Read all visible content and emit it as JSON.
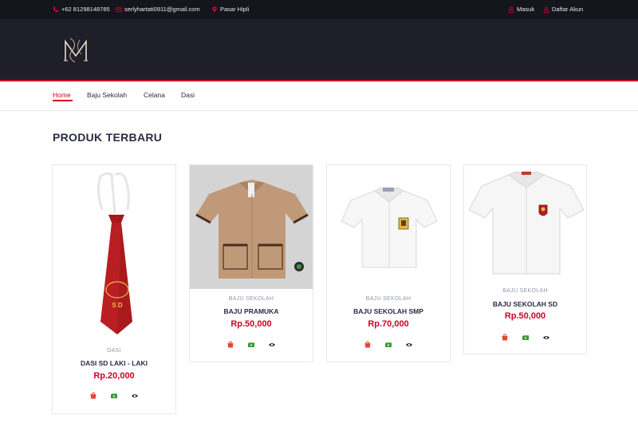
{
  "topbar": {
    "phone": "+62 81298148785",
    "email": "serlyhartati0911@gmail.com",
    "location": "Pasar Hipli",
    "login": "Masuk",
    "register": "Daftar Akun",
    "icons": [
      "phone-icon",
      "envelope-icon",
      "map-marker-icon",
      "user-icon",
      "user-icon"
    ]
  },
  "brand": {
    "logo_letters": "M"
  },
  "nav": {
    "items": [
      {
        "label": "Home",
        "active": true
      },
      {
        "label": "Baju Sekolah",
        "active": false
      },
      {
        "label": "Celana",
        "active": false
      },
      {
        "label": "Dasi",
        "active": false
      }
    ]
  },
  "section": {
    "title": "PRODUK TERBARU"
  },
  "products": [
    {
      "category": "DASI",
      "name": "DASI SD LAKI - LAKI",
      "price": "Rp.20,000",
      "image": "red-tie-image"
    },
    {
      "category": "BAJU SEKOLAH",
      "name": "BAJU PRAMUKA",
      "price": "Rp.50,000",
      "image": "scout-shirt-image"
    },
    {
      "category": "BAJU SEKOLAH",
      "name": "BAJU SEKOLAH SMP",
      "price": "Rp.70,000",
      "image": "white-smp-shirt-image"
    },
    {
      "category": "BAJU SEKOLAH",
      "name": "BAJU SEKOLAH SD",
      "price": "Rp.50,000",
      "image": "white-sd-shirt-image"
    }
  ],
  "product_actions": [
    "cart-icon",
    "money-icon",
    "eye-icon"
  ],
  "colors": {
    "accent": "#d10024",
    "topbar_bg": "#15161d",
    "header_bg": "#1e1f29",
    "cart_icon": "#e8472b",
    "money_icon": "#3a9a3a"
  }
}
